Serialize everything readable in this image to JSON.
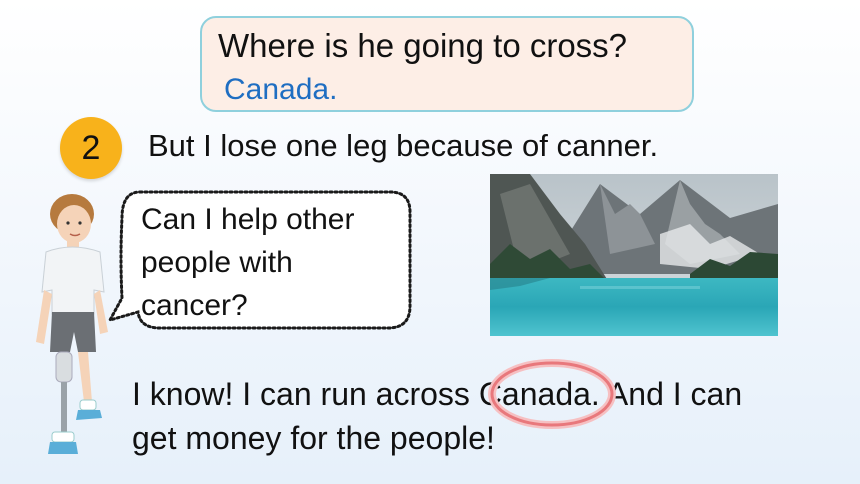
{
  "question": {
    "text": "Where is he going to cross?",
    "answer": "Canada."
  },
  "step": {
    "number": "2",
    "sentence": "But I lose one leg because of canner."
  },
  "speech_bubble": {
    "line1": "Can I help other",
    "line2": "people with",
    "line3": "cancer?"
  },
  "bottom": {
    "line1": "I know! I can run across Canada. And I can",
    "line2": "get money for the people!"
  },
  "colors": {
    "question_bg": "#fdeee6",
    "question_border": "#8fd0dd",
    "answer_text": "#1f6ec2",
    "badge": "#f8b21b",
    "highlight_circle": "#e8787c"
  },
  "images": {
    "photo": "mountain-lake-photo",
    "character": "boy-with-prosthetic-leg"
  }
}
